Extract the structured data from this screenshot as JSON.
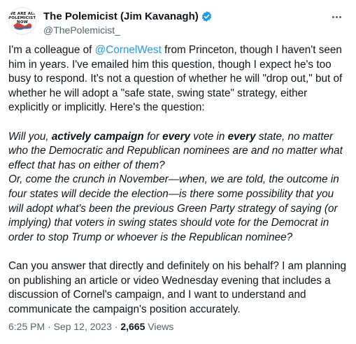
{
  "author": {
    "display_name": "The Polemicist (Jim Kavanagh)",
    "handle": "@ThePolemicist_",
    "avatar_text": "WE ARE ALL POLEMICISTS NOW",
    "verified_icon": "verified-badge-icon",
    "verified_color": "#1d9bf0"
  },
  "more_icon": "more-options-icon",
  "tweet": {
    "p1_before": "I'm a colleague of ",
    "p1_mention": "@CornelWest",
    "p1_after": " from Princeton, though I haven't seen him in years. I've emailed him this question, though I expect he's too busy to respond. It's not a question of whether he will \"drop out,\" but of whether he will adopt a \"safe state, swing state\" strategy, either explicitly or implicitly. Here's the question:",
    "q1_a": "Will you, ",
    "q1_b": "actively campaign",
    "q1_c": " for ",
    "q1_d": "every",
    "q1_e": " vote in ",
    "q1_f": "every",
    "q1_g": " state, no matter who the Democratic and Republican nominees are and no matter what effect that has on either of them?",
    "q2": "Or, come the crunch in November—when, we are told, the outcome in four states will decide the election—is there some possibility that you will adopt what's been the previous Green Party strategy of saying (or implying) that voters in swing states should vote for the Democrat in order to stop Trump or whoever is the Republican nominee?",
    "p3": "Can you answer that directly and definitely on his behalf? I am planning on publishing an article or video Wednesday evening that includes a discussion of Cornel's campaign, and I want to understand and communicate the campaign's position accurately."
  },
  "meta": {
    "timestamp": "6:25 PM · Sep 12, 2023",
    "separator": " · ",
    "views_count": "2,665",
    "views_label": " Views"
  },
  "colors": {
    "text": "#0f1419",
    "secondary": "#536471",
    "link": "#1d9bf0"
  }
}
